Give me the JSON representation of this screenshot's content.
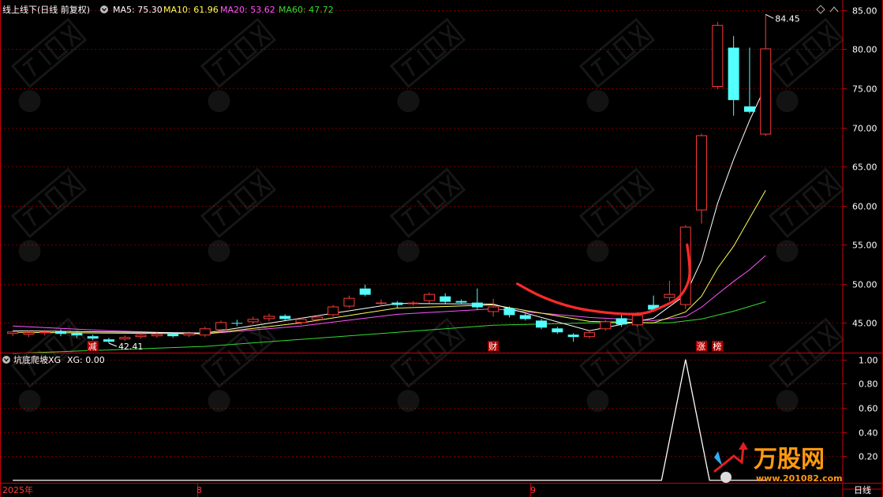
{
  "header": {
    "title": "线上线下(日线 前复权)",
    "ma5": "MA5: 75.30",
    "ma10": "MA10: 61.96",
    "ma20": "MA20: 53.62",
    "ma60": "MA60: 47.72"
  },
  "sub_header": {
    "title": "坑底爬坡XG",
    "xg": "XG: 0.00"
  },
  "footer": {
    "year": "2025年",
    "month8": "8",
    "month9": "9",
    "period": "日线"
  },
  "markers": {
    "m1": "减",
    "m2": "财",
    "m3": "涨",
    "m4": "榜"
  },
  "watermark": {
    "logo_text": "万股网",
    "url": "www.201082.com"
  },
  "colors": {
    "up": "#ff3a3a",
    "down": "#54ffff",
    "ma5": "#ffffff",
    "ma10": "#ffff55",
    "ma20": "#ff55ff",
    "ma60": "#33dd33",
    "axis": "#c8000a",
    "text": "#ffffff"
  },
  "chart_data": [
    {
      "type": "candlestick",
      "y_ticks": [
        45,
        50,
        55,
        60,
        65,
        70,
        75,
        80,
        85
      ],
      "y_tick_labels": [
        "45.00",
        "50.00",
        "55.00",
        "60.00",
        "65.00",
        "70.00",
        "75.00",
        "80.00",
        "85.00"
      ],
      "ylim": [
        41.2,
        86.3
      ],
      "annotations": {
        "max": "84.45",
        "min": "42.41"
      },
      "candles": [
        [
          43.6,
          43.9,
          43.3,
          44.0
        ],
        [
          43.5,
          43.8,
          43.2,
          44.0
        ],
        [
          43.7,
          43.9,
          43.4,
          44.1
        ],
        [
          43.9,
          43.6,
          43.3,
          44.2
        ],
        [
          43.7,
          43.4,
          43.1,
          43.9
        ],
        [
          43.3,
          43.0,
          42.8,
          43.5
        ],
        [
          42.9,
          42.6,
          42.41,
          43.1
        ],
        [
          42.9,
          43.2,
          42.7,
          43.4
        ],
        [
          43.2,
          43.5,
          43.0,
          43.7
        ],
        [
          43.3,
          43.6,
          43.1,
          43.8
        ],
        [
          43.6,
          43.3,
          43.1,
          43.8
        ],
        [
          43.4,
          43.7,
          43.2,
          43.9
        ],
        [
          43.4,
          44.3,
          43.2,
          44.5
        ],
        [
          44.1,
          45.1,
          43.9,
          45.3
        ],
        [
          45.0,
          44.9,
          44.6,
          45.4
        ],
        [
          45.1,
          45.5,
          44.9,
          45.8
        ],
        [
          45.5,
          45.9,
          45.2,
          46.2
        ],
        [
          45.9,
          45.5,
          45.3,
          46.1
        ],
        [
          45.0,
          45.5,
          44.8,
          45.7
        ],
        [
          45.4,
          45.8,
          45.2,
          46.0
        ],
        [
          46.0,
          47.1,
          45.8,
          47.3
        ],
        [
          47.1,
          48.2,
          46.9,
          48.5
        ],
        [
          49.4,
          48.6,
          48.4,
          49.9
        ],
        [
          47.5,
          47.6,
          47.1,
          48.0
        ],
        [
          47.6,
          47.3,
          46.9,
          47.8
        ],
        [
          47.4,
          47.6,
          47.2,
          47.8
        ],
        [
          47.8,
          48.7,
          47.5,
          48.9
        ],
        [
          48.4,
          47.7,
          47.5,
          48.8
        ],
        [
          47.8,
          47.6,
          47.4,
          48.0
        ],
        [
          47.6,
          47.0,
          46.7,
          49.4
        ],
        [
          46.4,
          47.1,
          45.8,
          48.1
        ],
        [
          46.9,
          46.0,
          45.7,
          47.1
        ],
        [
          46.0,
          45.5,
          45.3,
          46.2
        ],
        [
          45.3,
          44.4,
          44.2,
          45.5
        ],
        [
          44.3,
          43.8,
          43.6,
          44.5
        ],
        [
          43.5,
          43.2,
          42.6,
          43.7
        ],
        [
          43.2,
          43.8,
          43.0,
          44.0
        ],
        [
          44.2,
          45.2,
          44.0,
          45.4
        ],
        [
          45.6,
          44.8,
          44.5,
          46.1
        ],
        [
          44.7,
          46.0,
          44.5,
          46.4
        ],
        [
          47.3,
          46.7,
          46.4,
          48.5
        ],
        [
          48.2,
          48.7,
          47.8,
          50.4
        ],
        [
          47.3,
          57.3,
          46.8,
          57.5
        ],
        [
          59.4,
          69.0,
          57.7,
          69.2
        ],
        [
          75.2,
          83.1,
          74.9,
          83.5
        ],
        [
          80.2,
          73.5,
          71.5,
          81.7
        ],
        [
          72.7,
          72.0,
          71.8,
          80.2
        ],
        [
          69.1,
          80.1,
          68.9,
          84.45
        ]
      ],
      "ma5": [
        [
          0,
          44.0
        ],
        [
          12,
          43.7
        ],
        [
          18,
          45.6
        ],
        [
          24,
          47.5
        ],
        [
          30,
          47.4
        ],
        [
          36,
          44.0
        ],
        [
          40,
          45.6
        ],
        [
          42,
          48.6
        ],
        [
          43,
          53.0
        ],
        [
          44,
          60.3
        ],
        [
          45,
          65.9
        ],
        [
          46,
          70.9
        ],
        [
          47,
          75.3
        ]
      ],
      "ma10": [
        [
          0,
          43.8
        ],
        [
          12,
          43.6
        ],
        [
          18,
          45.0
        ],
        [
          24,
          46.9
        ],
        [
          30,
          47.3
        ],
        [
          36,
          45.2
        ],
        [
          40,
          45.0
        ],
        [
          42,
          46.4
        ],
        [
          43,
          48.4
        ],
        [
          44,
          52.0
        ],
        [
          45,
          54.8
        ],
        [
          46,
          58.4
        ],
        [
          47,
          61.96
        ]
      ],
      "ma20": [
        [
          0,
          44.6
        ],
        [
          6,
          44.0
        ],
        [
          12,
          43.6
        ],
        [
          18,
          44.6
        ],
        [
          24,
          46.1
        ],
        [
          30,
          46.8
        ],
        [
          36,
          45.7
        ],
        [
          40,
          45.3
        ],
        [
          42,
          45.8
        ],
        [
          43,
          47.0
        ],
        [
          44,
          48.7
        ],
        [
          45,
          50.3
        ],
        [
          46,
          51.8
        ],
        [
          47,
          53.62
        ]
      ],
      "ma60": [
        [
          0,
          41.1
        ],
        [
          12,
          42.0
        ],
        [
          24,
          43.8
        ],
        [
          30,
          44.7
        ],
        [
          36,
          45.0
        ],
        [
          41,
          45.0
        ],
        [
          43,
          45.5
        ],
        [
          45,
          46.5
        ],
        [
          47,
          47.72
        ]
      ],
      "hand_curve": [
        [
          31.5,
          50.0
        ],
        [
          33,
          48.3
        ],
        [
          35,
          46.9
        ],
        [
          37,
          46.3
        ],
        [
          38.5,
          46.1
        ],
        [
          39.5,
          46.2
        ],
        [
          40.5,
          47.0
        ],
        [
          41.5,
          48.0
        ],
        [
          42,
          49.3
        ],
        [
          42.3,
          51.0
        ],
        [
          42.2,
          53.5
        ],
        [
          42.1,
          55.0
        ]
      ],
      "markers": [
        [
          5,
          "m1"
        ],
        [
          30,
          "m2"
        ],
        [
          43,
          "m3"
        ],
        [
          44,
          "m4"
        ]
      ]
    },
    {
      "type": "line",
      "name": "XG",
      "y_ticks": [
        0.2,
        0.4,
        0.6,
        0.8,
        1.0
      ],
      "y_tick_labels": [
        "0.20",
        "0.40",
        "0.60",
        "0.80",
        "1.00"
      ],
      "ylim": [
        -0.02,
        1.05
      ],
      "points": [
        [
          0,
          0
        ],
        [
          40.5,
          0
        ],
        [
          42,
          1
        ],
        [
          43.5,
          0
        ],
        [
          47,
          0
        ]
      ]
    }
  ]
}
